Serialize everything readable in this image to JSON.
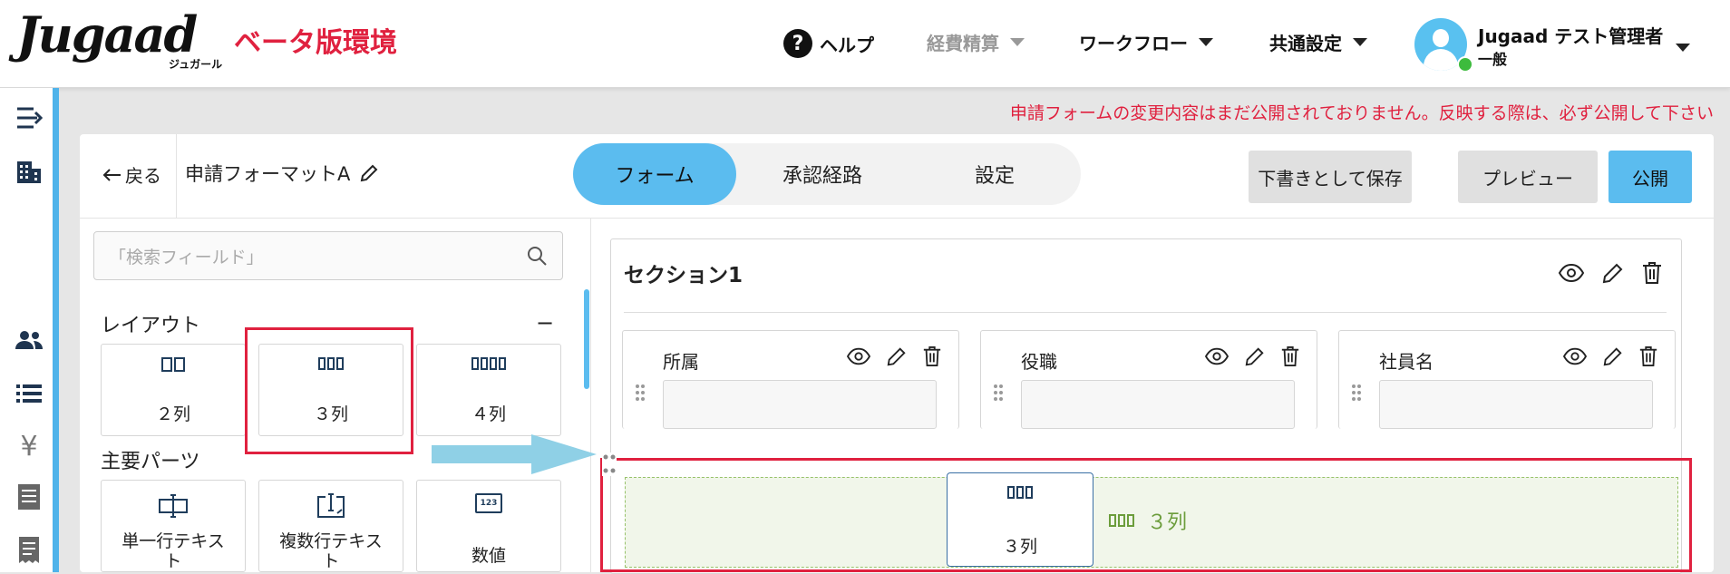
{
  "header": {
    "logo_text": "Jugaad",
    "logo_sub": "ジュガール",
    "env_label": "ベータ版環境",
    "help_label": "ヘルプ",
    "nav": [
      {
        "label": "経費精算",
        "disabled": true
      },
      {
        "label": "ワークフロー",
        "disabled": false
      },
      {
        "label": "共通設定",
        "disabled": false
      }
    ],
    "user_name": "Jugaad テスト管理者",
    "user_role": "一般"
  },
  "rail_icons": [
    "menu-expand-icon",
    "building-icon",
    "users-icon",
    "list-icon",
    "yen-icon",
    "document-icon",
    "receipt-icon"
  ],
  "notice": "申請フォームの変更内容はまだ公開されておりません。反映する際は、必ず公開して下さい",
  "editor": {
    "back_label": "戻る",
    "form_name": "申請フォーマットA",
    "tabs": [
      {
        "label": "フォーム",
        "active": true
      },
      {
        "label": "承認経路",
        "active": false
      },
      {
        "label": "設定",
        "active": false
      }
    ],
    "buttons": {
      "draft": "下書きとして保存",
      "preview": "プレビュー",
      "publish": "公開"
    }
  },
  "palette": {
    "search_placeholder": "「検索フィールド」",
    "layout_title": "レイアウト",
    "collapse_symbol": "−",
    "layout_items": [
      "２列",
      "３列",
      "４列"
    ],
    "parts_title": "主要パーツ",
    "parts_items": [
      {
        "line1": "単一行テキス",
        "line2": "ト"
      },
      {
        "line1": "複数行テキス",
        "line2": "ト"
      },
      {
        "line1": "数値",
        "line2": ""
      }
    ],
    "number_icon_text": "123"
  },
  "canvas": {
    "section_title": "セクション1",
    "fields": [
      "所属",
      "役職",
      "社員名"
    ],
    "drop_label": "３列",
    "drag_label": "３列"
  }
}
